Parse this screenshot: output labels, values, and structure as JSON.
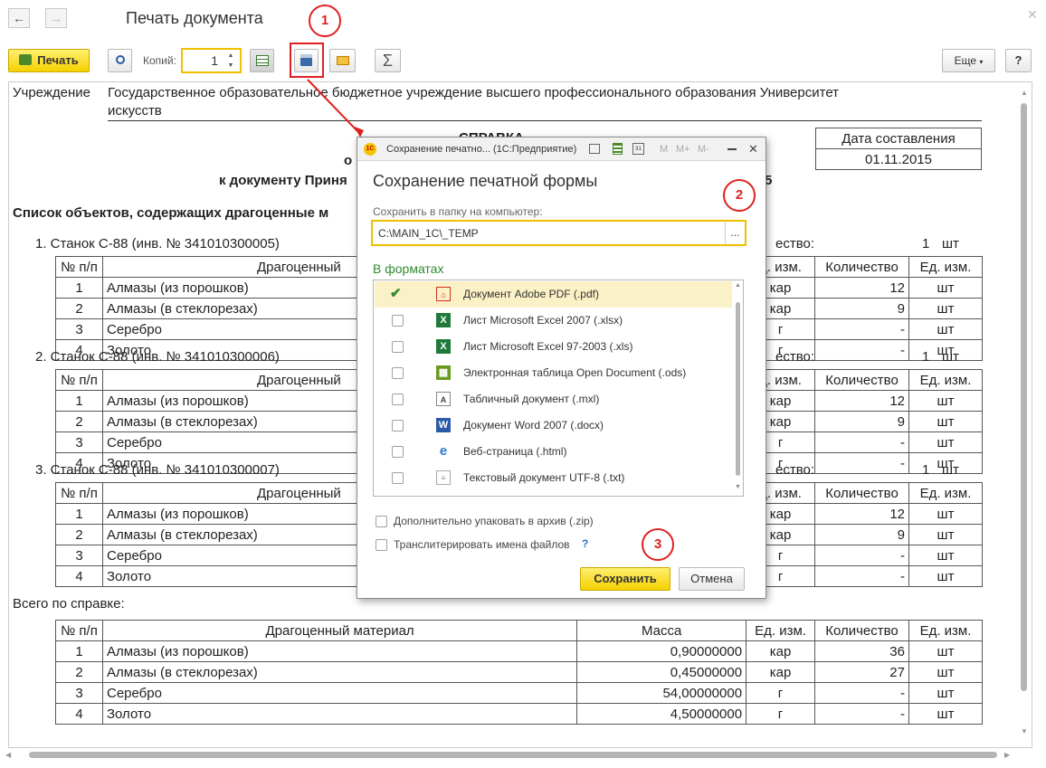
{
  "window": {
    "title": "Печать документа",
    "more_label": "Еще",
    "help_label": "?"
  },
  "toolbar": {
    "print_label": "Печать",
    "copies_label": "Копий:",
    "copies_value": "1",
    "sum_symbol": "Σ"
  },
  "doc": {
    "inst_label": "Учреждение",
    "inst_line1": "Государственное образовательное бюджетное учреждение высшего профессионального образования  Университет",
    "inst_line2": "искусств",
    "title": "СПРАВКА",
    "title2": "о",
    "title3": "к документу Приня",
    "title3_tail": "5",
    "date_header": "Дата составления",
    "date_value": "01.11.2015",
    "list_title": "Список объектов, содержащих драгоценные м",
    "headers": {
      "num": "№ п/п",
      "material": "Драгоценный материал",
      "material_cut": "Драгоценный",
      "mass": "Масса",
      "unit_cut": "д. изм.",
      "unit": "Ед. изм.",
      "qty": "Количество",
      "unit2": "Ед. изм."
    },
    "objects": [
      {
        "name": "1. Станок С-88 (инв. № 341010300005)",
        "qty_label": "ество:",
        "qty": "1",
        "qty_unit": "шт",
        "rows": [
          {
            "n": "1",
            "m": "Алмазы (из порошков)",
            "u": "кар",
            "q": "12",
            "u2": "шт"
          },
          {
            "n": "2",
            "m": "Алмазы (в стеклорезах)",
            "u": "кар",
            "q": "9",
            "u2": "шт"
          },
          {
            "n": "3",
            "m": "Серебро",
            "u": "г",
            "q": "-",
            "u2": "шт"
          },
          {
            "n": "4",
            "m": "Золото",
            "u": "г",
            "q": "-",
            "u2": "шт"
          }
        ]
      },
      {
        "name": "2. Станок С-88 (инв. № 341010300006)",
        "qty_label": "ество:",
        "qty": "1",
        "qty_unit": "шт",
        "rows": [
          {
            "n": "1",
            "m": "Алмазы (из порошков)",
            "u": "кар",
            "q": "12",
            "u2": "шт"
          },
          {
            "n": "2",
            "m": "Алмазы (в стеклорезах)",
            "u": "кар",
            "q": "9",
            "u2": "шт"
          },
          {
            "n": "3",
            "m": "Серебро",
            "u": "г",
            "q": "-",
            "u2": "шт"
          },
          {
            "n": "4",
            "m": "Золото",
            "u": "г",
            "q": "-",
            "u2": "шт"
          }
        ]
      },
      {
        "name": "3. Станок С-88 (инв. № 341010300007)",
        "qty_label": "ество:",
        "qty": "1",
        "qty_unit": "шт",
        "rows": [
          {
            "n": "1",
            "m": "Алмазы (из порошков)",
            "u": "кар",
            "q": "12",
            "u2": "шт"
          },
          {
            "n": "2",
            "m": "Алмазы (в стеклорезах)",
            "u": "кар",
            "q": "9",
            "u2": "шт"
          },
          {
            "n": "3",
            "m": "Серебро",
            "u": "г",
            "q": "-",
            "u2": "шт"
          },
          {
            "n": "4",
            "m": "Золото",
            "u": "г",
            "q": "-",
            "u2": "шт"
          }
        ]
      }
    ],
    "total_label": "Всего по справке:",
    "total_rows": [
      {
        "n": "1",
        "m": "Алмазы (из порошков)",
        "mass": "0,90000000",
        "u": "кар",
        "q": "36",
        "u2": "шт"
      },
      {
        "n": "2",
        "m": "Алмазы (в стеклорезах)",
        "mass": "0,45000000",
        "u": "кар",
        "q": "27",
        "u2": "шт"
      },
      {
        "n": "3",
        "m": "Серебро",
        "mass": "54,00000000",
        "u": "г",
        "q": "-",
        "u2": "шт"
      },
      {
        "n": "4",
        "m": "Золото",
        "mass": "4,50000000",
        "u": "г",
        "q": "-",
        "u2": "шт"
      }
    ]
  },
  "dialog": {
    "window_title": "Сохранение печатно... (1С:Предприятие)",
    "title_m": "M",
    "title_mplus": "M+",
    "title_mminus": "M-",
    "heading": "Сохранение печатной формы",
    "folder_label": "Сохранить в папку на компьютер:",
    "folder_value": "C:\\MAIN_1C\\_TEMP",
    "browse_label": "...",
    "formats_label": "В форматах",
    "formats": [
      {
        "label": "Документ Adobe PDF (.pdf)",
        "checked": true,
        "icon": "pdf-icon"
      },
      {
        "label": "Лист Microsoft Excel 2007 (.xlsx)",
        "checked": false,
        "icon": "excel-icon"
      },
      {
        "label": "Лист Microsoft Excel 97-2003 (.xls)",
        "checked": false,
        "icon": "excel-icon"
      },
      {
        "label": "Электронная таблица Open Document (.ods)",
        "checked": false,
        "icon": "ods-icon"
      },
      {
        "label": "Табличный документ (.mxl)",
        "checked": false,
        "icon": "mxl-icon"
      },
      {
        "label": "Документ Word 2007 (.docx)",
        "checked": false,
        "icon": "word-icon"
      },
      {
        "label": "Веб-страница (.html)",
        "checked": false,
        "icon": "html-icon"
      },
      {
        "label": "Текстовый документ UTF-8 (.txt)",
        "checked": false,
        "icon": "txt-icon"
      }
    ],
    "zip_label": "Дополнительно упаковать в архив (.zip)",
    "translit_label": "Транслитерировать имена файлов",
    "help_mark": "?",
    "save_label": "Сохранить",
    "cancel_label": "Отмена"
  },
  "callouts": [
    "1",
    "2",
    "3"
  ],
  "colors": {
    "accent_yellow": "#f5d100",
    "callout_red": "#e02020",
    "formats_green": "#2e8b2e"
  }
}
